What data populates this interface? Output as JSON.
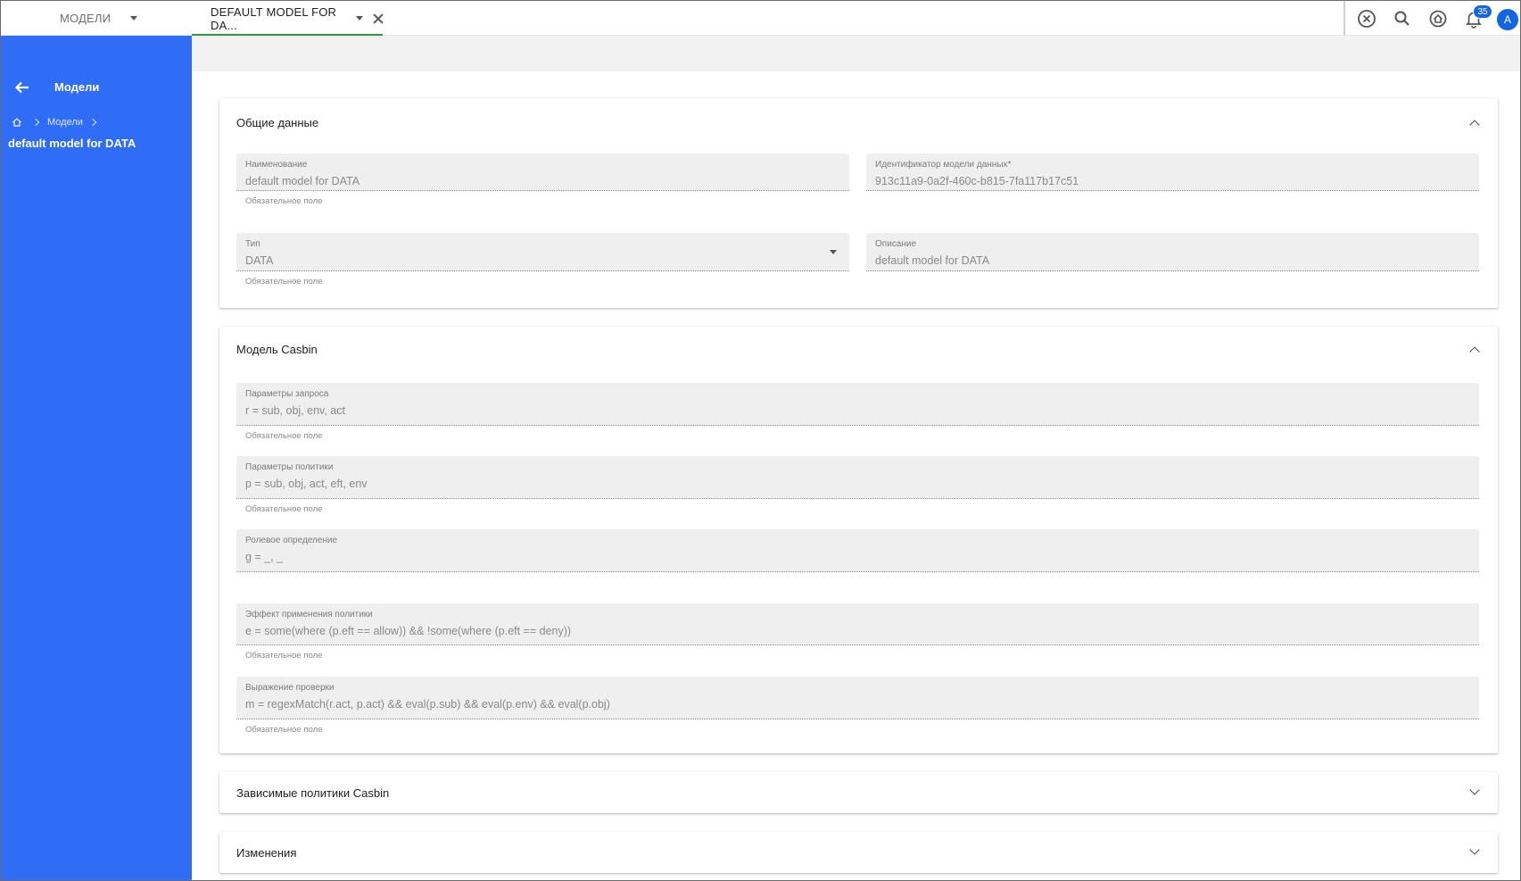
{
  "topbar": {
    "tabs": [
      {
        "label": "МОДЕЛИ"
      },
      {
        "label": "DEFAULT MODEL FOR DA..."
      }
    ],
    "notifications_count": "35",
    "avatar_letter": "A"
  },
  "sidebar": {
    "title": "Модели",
    "breadcrumb": [
      "Модели"
    ],
    "current": "default model for DATA"
  },
  "sections": {
    "general": {
      "title": "Общие данные",
      "fields": {
        "name": {
          "label": "Наименование",
          "value": "default model for DATA",
          "hint": "Обязательное поле"
        },
        "model_id": {
          "label": "Идентификатор модели данных*",
          "value": "913c11a9-0a2f-460c-b815-7fa117b17c51"
        },
        "type": {
          "label": "Тип",
          "value": "DATA",
          "hint": "Обязательное поле"
        },
        "description": {
          "label": "Описание",
          "value": "default model for DATA"
        }
      }
    },
    "casbin": {
      "title": "Модель Casbin",
      "fields": {
        "request": {
          "label": "Параметры запроса",
          "value": "r = sub, obj, env, act",
          "hint": "Обязательное поле"
        },
        "policy": {
          "label": "Параметры политики",
          "value": "p = sub, obj, act, eft, env",
          "hint": "Обязательное поле"
        },
        "role": {
          "label": "Ролевое определение",
          "value": "g = _, _"
        },
        "effect": {
          "label": "Эффект применения политики",
          "value": "e = some(where (p.eft == allow)) && !some(where (p.eft == deny))",
          "hint": "Обязательное поле"
        },
        "matcher": {
          "label": "Выражение проверки",
          "value": "m = regexMatch(r.act, p.act) && eval(p.sub) && eval(p.env) && eval(p.obj)",
          "hint": "Обязательное поле"
        }
      }
    },
    "dependent": {
      "title": "Зависимые политики Casbin"
    },
    "changes": {
      "title": "Изменения"
    }
  }
}
